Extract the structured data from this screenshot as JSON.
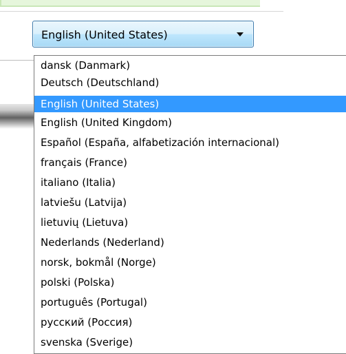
{
  "language_selector": {
    "selected_value": "English (United States)",
    "options": [
      "dansk (Danmark)",
      "Deutsch (Deutschland)",
      "English (United States)",
      "English (United Kingdom)",
      "Español (España, alfabetización internacional)",
      "français (France)",
      "italiano (Italia)",
      "latviešu (Latvija)",
      "lietuvių (Lietuva)",
      "Nederlands (Nederland)",
      "norsk, bokmål (Norge)",
      "polski (Polska)",
      "português (Portugal)",
      "русский (Россия)",
      "svenska (Sverige)"
    ],
    "selected_index": 2
  },
  "colors": {
    "selection_highlight": "#3399ff",
    "combo_border": "#3d7bad",
    "top_strip": "#e6f6dc"
  }
}
